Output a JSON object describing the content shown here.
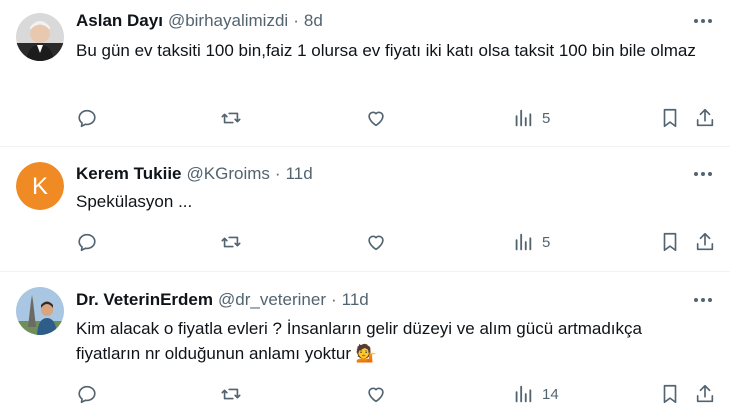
{
  "tweets": [
    {
      "author": "Aslan Dayı",
      "handle": "@birhayalimizdi",
      "separator": "·",
      "time": "8d",
      "text": "Bu gün ev taksiti 100 bin,faiz 1 olursa ev fiyatı iki katı olsa taksit 100 bin bile olmaz",
      "emoji": "",
      "views": "5",
      "avatar_icon": "person-photo-avatar"
    },
    {
      "author": "Kerem Tukiie",
      "handle": "@KGroims",
      "separator": "·",
      "time": "11d",
      "text": "Spekülasyon ...",
      "emoji": "",
      "views": "5",
      "avatar_letter": "K",
      "avatar_color": "#f08a24"
    },
    {
      "author": "Dr. VeterinErdem",
      "handle": "@dr_veteriner",
      "separator": "·",
      "time": "11d",
      "text": "Kim alacak o fiyatla evleri ? İnsanların gelir düzeyi ve alım gücü artmadıkça fiyatların nr olduğunun anlamı yoktur ",
      "emoji": "💁",
      "views": "14",
      "avatar_icon": "eiffel-tower-photo-avatar"
    }
  ],
  "colors": {
    "text": "#0f1419",
    "secondary": "#536471",
    "divider": "#eff3f4"
  },
  "icons": [
    "reply-icon",
    "retweet-icon",
    "like-icon",
    "views-icon",
    "bookmark-icon",
    "share-icon",
    "more-icon"
  ]
}
